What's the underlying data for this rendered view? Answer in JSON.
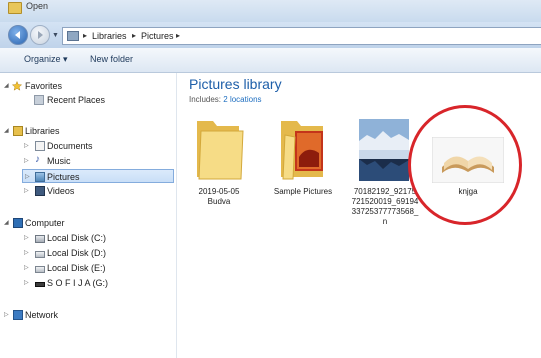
{
  "window": {
    "title": "Open"
  },
  "address": {
    "crumbs": [
      "Libraries",
      "Pictures"
    ]
  },
  "toolbar": {
    "organize_label": "Organize ▾",
    "new_folder_label": "New folder"
  },
  "sidebar": {
    "favorites": {
      "label": "Favorites",
      "items": [
        {
          "label": "Recent Places"
        }
      ]
    },
    "libraries": {
      "label": "Libraries",
      "items": [
        {
          "label": "Documents"
        },
        {
          "label": "Music"
        },
        {
          "label": "Pictures",
          "selected": true
        },
        {
          "label": "Videos"
        }
      ]
    },
    "computer": {
      "label": "Computer",
      "items": [
        {
          "label": "Local Disk (C:)"
        },
        {
          "label": "Local Disk (D:)"
        },
        {
          "label": "Local Disk (E:)"
        },
        {
          "label": "S O F I J A (G:)"
        }
      ]
    },
    "network": {
      "label": "Network"
    }
  },
  "main": {
    "title": "Pictures library",
    "includes_prefix": "Includes:",
    "includes_link": "2 locations",
    "items": [
      {
        "name": "2019-05-05\nBudva",
        "type": "folder"
      },
      {
        "name": "Sample Pictures",
        "type": "folder-photos"
      },
      {
        "name": "70182192_921757721520019_6919433725377773568_n",
        "display": "70182192_92175\n721520019_69194\n33725377773568_\nn",
        "type": "image-reflection"
      },
      {
        "name": "knjga",
        "type": "image-book"
      }
    ]
  },
  "colors": {
    "accent": "#1e5fa9",
    "highlight": "#d8252a",
    "selection": "#c9dff7"
  }
}
